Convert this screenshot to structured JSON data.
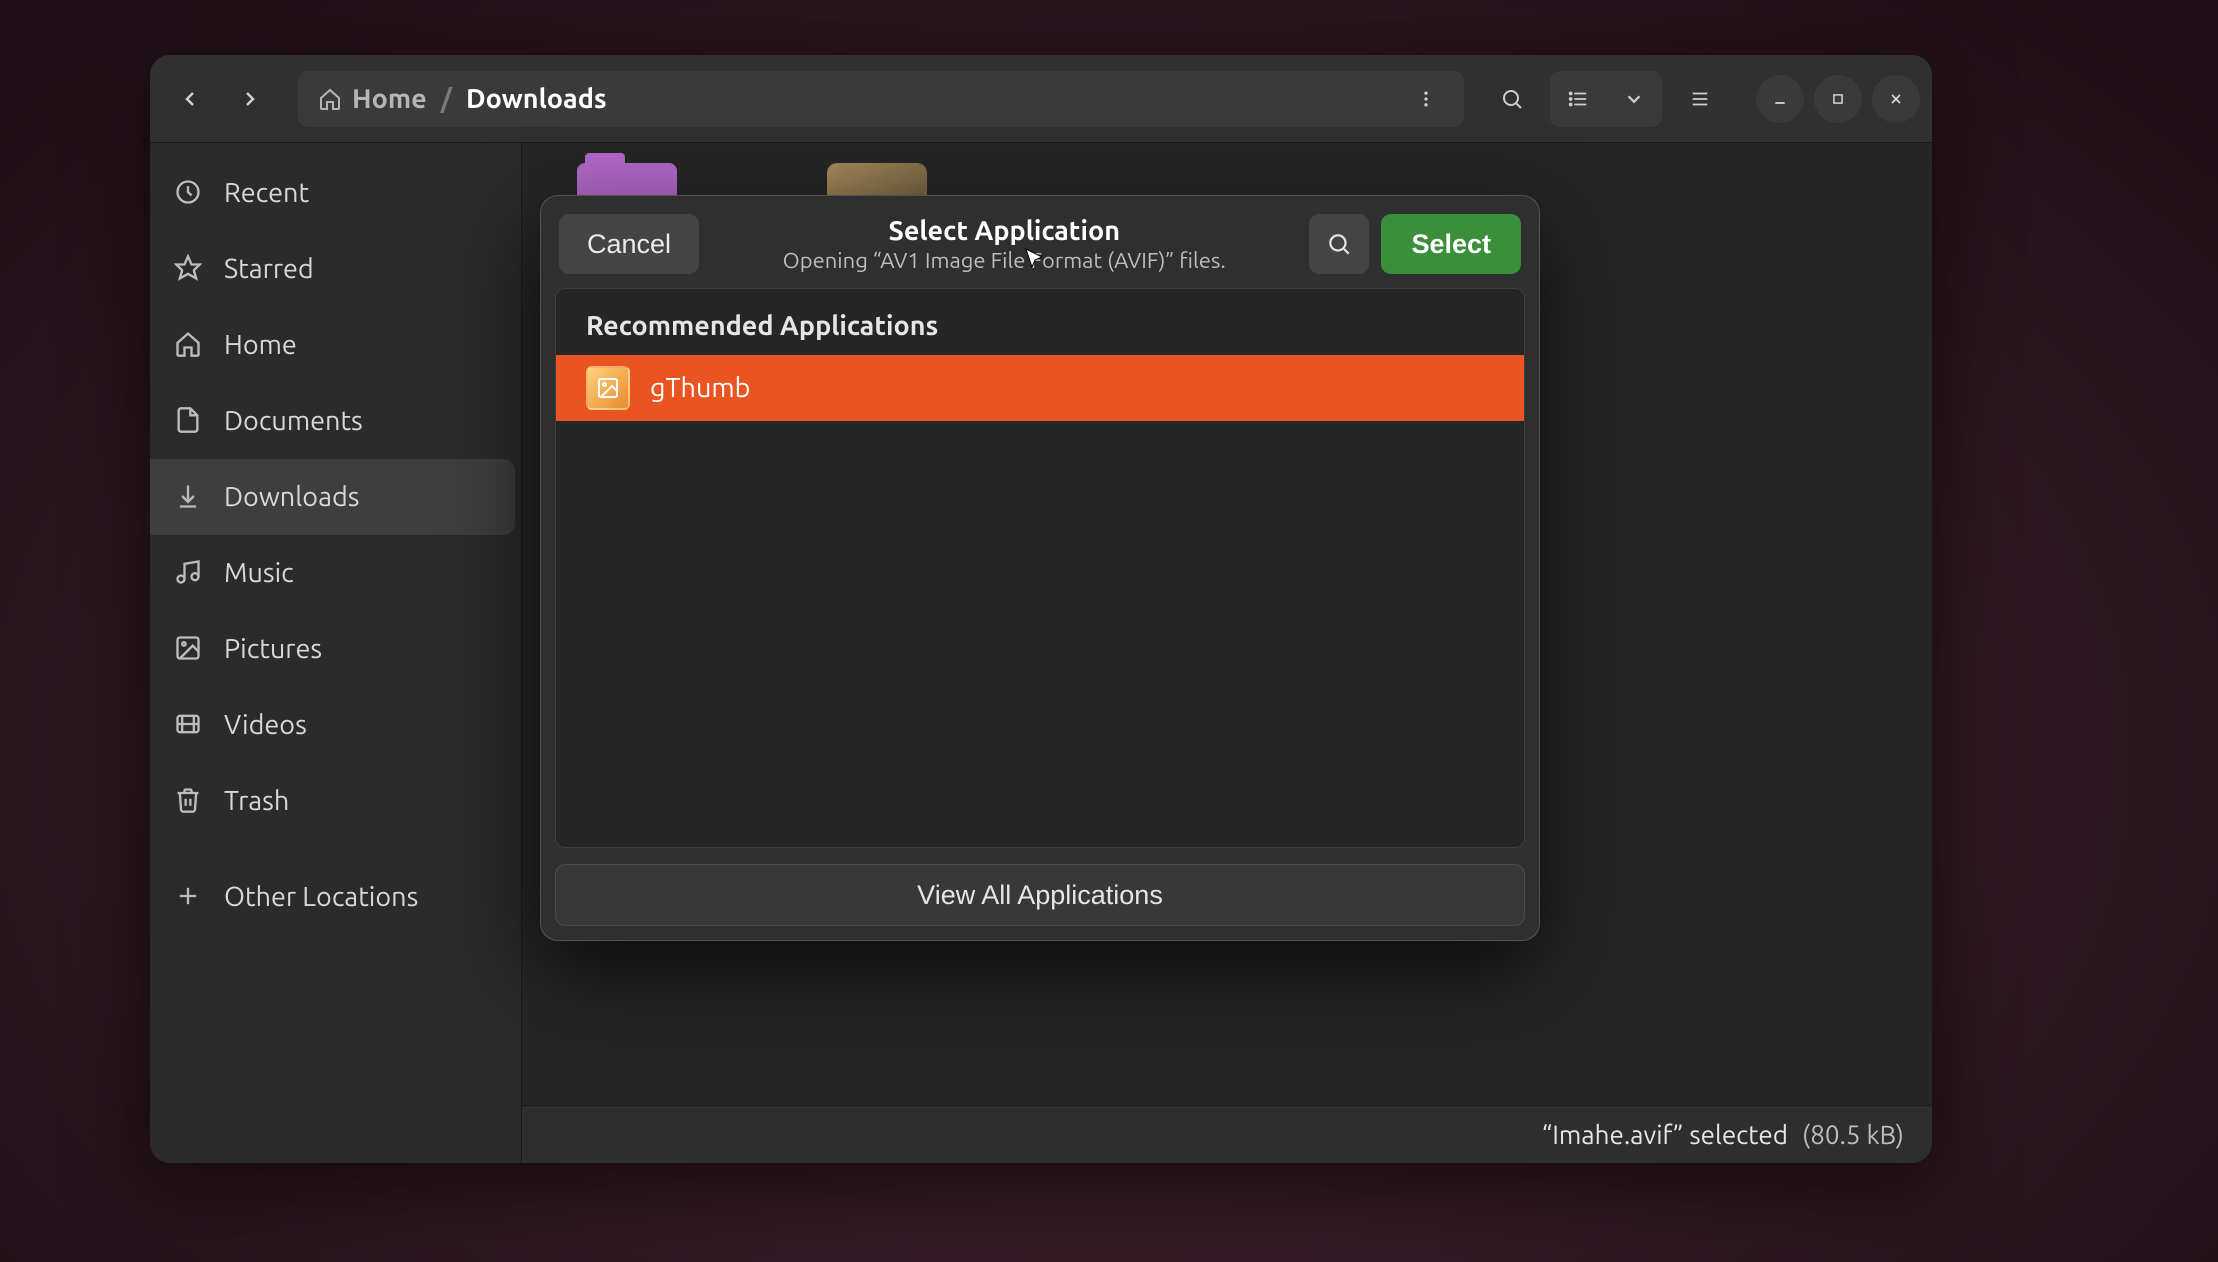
{
  "pathbar": {
    "home_label": "Home",
    "separator": "/",
    "current": "Downloads"
  },
  "sidebar": {
    "items": [
      {
        "icon": "recent",
        "label": "Recent"
      },
      {
        "icon": "starred",
        "label": "Starred"
      },
      {
        "icon": "home",
        "label": "Home"
      },
      {
        "icon": "document",
        "label": "Documents"
      },
      {
        "icon": "download",
        "label": "Downloads"
      },
      {
        "icon": "music",
        "label": "Music"
      },
      {
        "icon": "picture",
        "label": "Pictures"
      },
      {
        "icon": "video",
        "label": "Videos"
      },
      {
        "icon": "trash",
        "label": "Trash"
      },
      {
        "icon": "plus",
        "label": "Other Locations"
      }
    ],
    "active_index": 4
  },
  "statusbar": {
    "selection": "“Imahe.avif” selected",
    "size": "(80.5 kB)"
  },
  "dialog": {
    "cancel_label": "Cancel",
    "title": "Select Application",
    "subtitle": "Opening “AV1 Image File Format (AVIF)” files.",
    "select_label": "Select",
    "section_label": "Recommended Applications",
    "apps": [
      {
        "name": "gThumb"
      }
    ],
    "selected_app_index": 0,
    "view_all_label": "View All Applications"
  }
}
